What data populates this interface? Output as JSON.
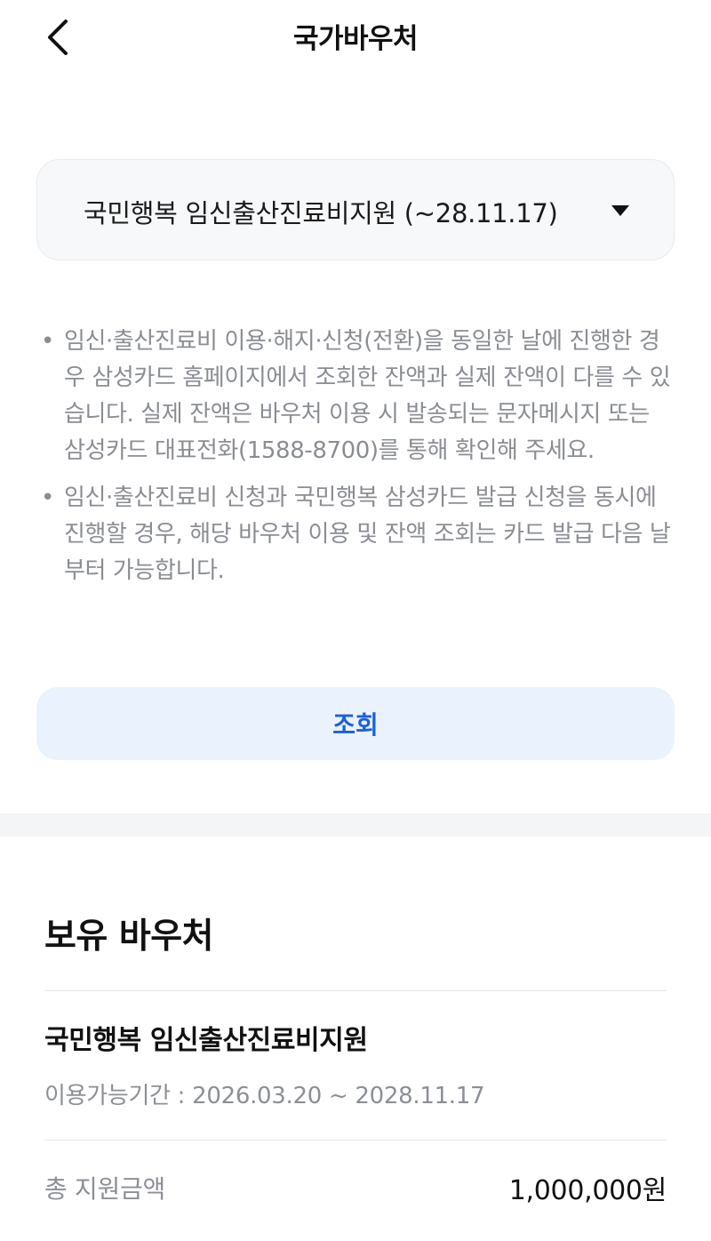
{
  "header": {
    "title": "국가바우처",
    "back_icon": "chevron-left-icon"
  },
  "voucher_select": {
    "selected": "국민행복 임신출산진료비지원 (~28.11.17)",
    "caret_icon": "caret-down-icon"
  },
  "notices": [
    {
      "bullet": "•",
      "text": "임신·출산진료비 이용·해지·신청(전환)을 동일한 날에 진행한 경우 삼성카드 홈페이지에서 조회한 잔액과 실제 잔액이 다를 수 있습니다. 실제 잔액은 바우처 이용 시 발송되는 문자메시지 또는 삼성카드 대표전화(1588-8700)를 통해 확인해 주세요."
    },
    {
      "bullet": "•",
      "text": "임신·출산진료비 신청과 국민행복 삼성카드 발급 신청을 동시에 진행할 경우, 해당 바우처 이용 및 잔액 조회는 카드 발급 다음 날부터 가능합니다."
    }
  ],
  "query_button": {
    "label": "조회"
  },
  "owned": {
    "title": "보유 바우처",
    "voucher_name": "국민행복 임신출산진료비지원",
    "period": "이용가능기간 : 2026.03.20 ~ 2028.11.17",
    "total_label": "총 지원금액",
    "total_value": "1,000,000원"
  },
  "colors": {
    "accent": "#1b61d6",
    "button_bg": "#eaf2fd",
    "muted_text": "#8a8d93",
    "select_bg": "#f7f8fa"
  }
}
